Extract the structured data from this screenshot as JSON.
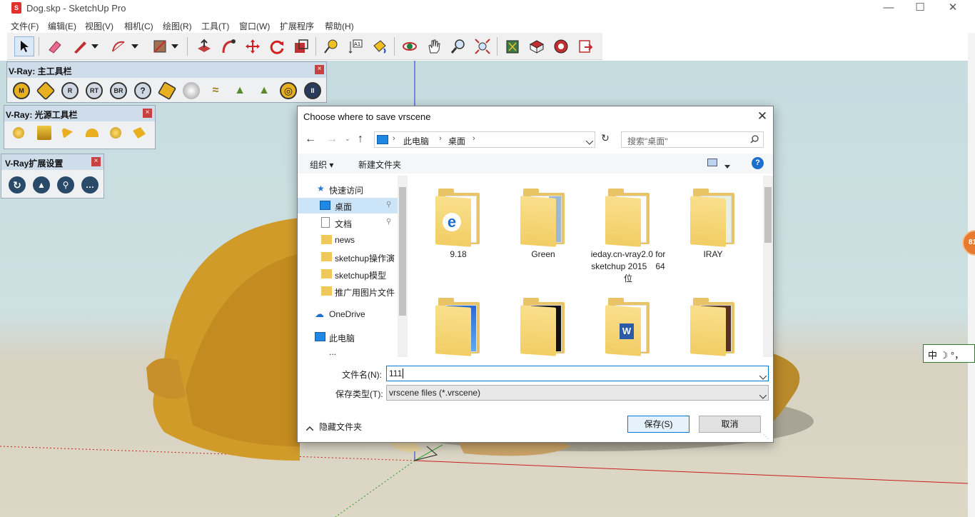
{
  "window": {
    "title": "Dog.skp - SketchUp Pro",
    "app_icon": "sketchup-logo-icon"
  },
  "menu": [
    "文件(F)",
    "编辑(E)",
    "视图(V)",
    "相机(C)",
    "绘图(R)",
    "工具(T)",
    "窗口(W)",
    "扩展程序",
    "帮助(H)"
  ],
  "toolbars": {
    "vray_main": {
      "title": "V-Ray: 主工具栏",
      "icons": [
        "M",
        "◆",
        "R",
        "RT",
        "BR",
        "?",
        "◈",
        "●",
        "≈",
        "▲",
        "▲",
        "◎",
        "II"
      ]
    },
    "vray_lights": {
      "title": "V-Ray: 光源工具栏"
    },
    "vray_ext": {
      "title": "V-Ray扩展设置"
    },
    "close": "×"
  },
  "dialog": {
    "title": "Choose where to save vrscene",
    "close": "✕",
    "breadcrumb": [
      "此电脑",
      "桌面"
    ],
    "breadcrumb_sep": "›",
    "search_placeholder": "搜索\"桌面\"",
    "organize": "组织 ▾",
    "new_folder": "新建文件夹",
    "help": "?",
    "nav": {
      "quick_access": "快速访问",
      "items": [
        "桌面",
        "文档",
        "news",
        "sketchup操作演",
        "sketchup模型",
        "推广用图片文件"
      ],
      "onedrive": "OneDrive",
      "this_pc": "此电脑",
      "partial": "..."
    },
    "files": [
      {
        "name": "9.18"
      },
      {
        "name": "Green"
      },
      {
        "name": "ieday.cn-vray2.0 for sketchup 2015　64位"
      },
      {
        "name": "IRAY"
      },
      {
        "name": ""
      },
      {
        "name": ""
      },
      {
        "name": ""
      },
      {
        "name": ""
      }
    ],
    "filename_label": "文件名(N):",
    "filename_value": "111",
    "filetype_label": "保存类型(T):",
    "filetype_value": "vrscene files (*.vrscene)",
    "hide_folders": "隐藏文件夹",
    "save": "保存(S)",
    "cancel": "取消"
  },
  "ime": {
    "text": "中 ☽ °，"
  },
  "badge": "81"
}
